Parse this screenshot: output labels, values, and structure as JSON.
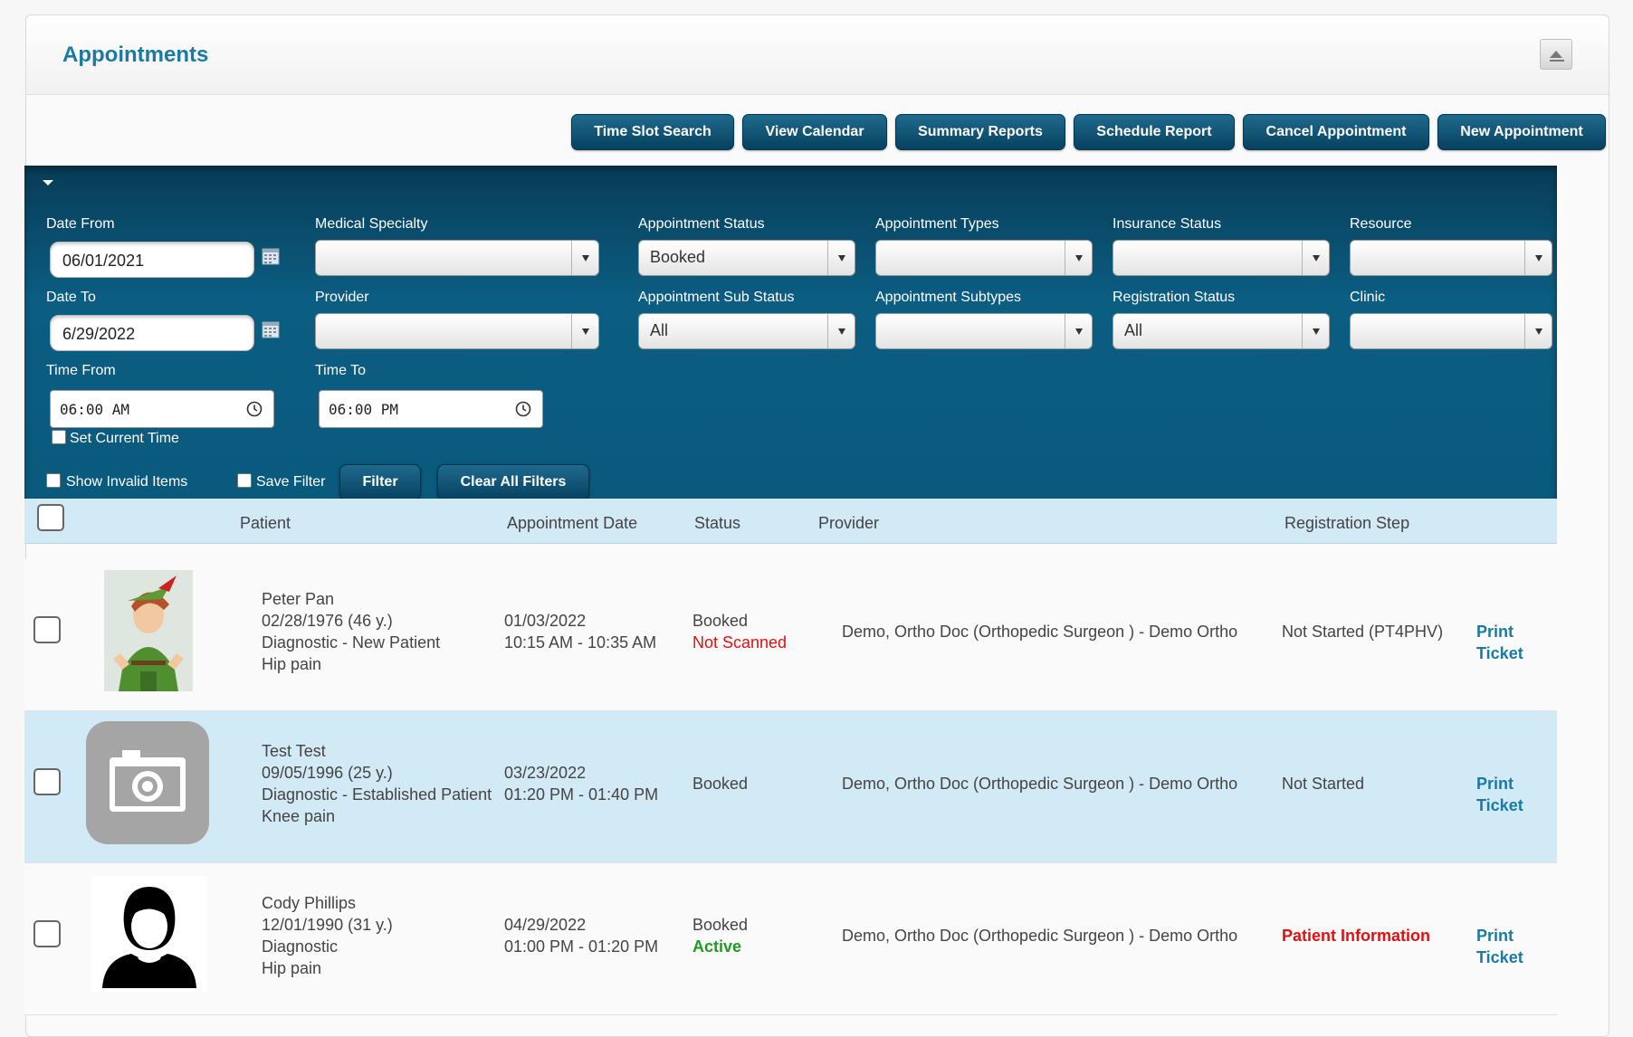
{
  "panel": {
    "title": "Appointments"
  },
  "toolbar": {
    "buttons": [
      "Time Slot Search",
      "View Calendar",
      "Summary Reports",
      "Schedule Report",
      "Cancel Appointment",
      "New Appointment"
    ]
  },
  "filters": {
    "date_from": {
      "label": "Date From",
      "value": "06/01/2021"
    },
    "date_to": {
      "label": "Date To",
      "value": "6/29/2022"
    },
    "time_from": {
      "label": "Time From",
      "value": "06:00 AM"
    },
    "time_to": {
      "label": "Time To",
      "value": "06:00 PM"
    },
    "set_current_time": "Set Current Time",
    "medical_specialty": {
      "label": "Medical Specialty",
      "value": ""
    },
    "provider": {
      "label": "Provider",
      "value": ""
    },
    "appointment_status": {
      "label": "Appointment Status",
      "value": "Booked"
    },
    "appointment_sub_status": {
      "label": "Appointment Sub Status",
      "value": "All"
    },
    "appointment_types": {
      "label": "Appointment Types",
      "value": ""
    },
    "appointment_subtypes": {
      "label": "Appointment Subtypes",
      "value": ""
    },
    "insurance_status": {
      "label": "Insurance Status",
      "value": ""
    },
    "registration_status": {
      "label": "Registration Status",
      "value": "All"
    },
    "resource": {
      "label": "Resource",
      "value": ""
    },
    "clinic": {
      "label": "Clinic",
      "value": ""
    },
    "show_invalid": "Show Invalid Items",
    "save_filter": "Save Filter",
    "filter_button": "Filter",
    "clear_button": "Clear All Filters"
  },
  "grid": {
    "headers": {
      "patient": "Patient",
      "date": "Appointment Date",
      "status": "Status",
      "provider": "Provider",
      "registration": "Registration Step"
    },
    "rows": [
      {
        "name": "Peter Pan",
        "dob": "02/28/1976 (46 y.)",
        "type": "Diagnostic - New Patient",
        "reason": "Hip pain",
        "date": "01/03/2022",
        "time": "10:15 AM - 10:35 AM",
        "status": "Booked",
        "sub_status": "Not Scanned",
        "provider": "Demo, Ortho Doc (Orthopedic Surgeon ) - Demo Ortho",
        "registration": "Not Started (PT4PHV)",
        "action": "Print Ticket"
      },
      {
        "name": "Test Test",
        "dob": "09/05/1996 (25 y.)",
        "type": "Diagnostic - Established Patient",
        "reason": "Knee pain",
        "date": "03/23/2022",
        "time": "01:20 PM - 01:40 PM",
        "status": "Booked",
        "sub_status": "",
        "provider": "Demo, Ortho Doc (Orthopedic Surgeon ) - Demo Ortho",
        "registration": "Not Started",
        "action": "Print Ticket"
      },
      {
        "name": "Cody Phillips",
        "dob": "12/01/1990 (31 y.)",
        "type": "Diagnostic",
        "reason": "Hip pain",
        "date": "04/29/2022",
        "time": "01:00 PM - 01:20 PM",
        "status": "Booked",
        "sub_status": "Active",
        "provider": "Demo, Ortho Doc (Orthopedic Surgeon ) - Demo Ortho",
        "registration": "Patient Information",
        "action": "Print Ticket"
      }
    ]
  },
  "colors": {
    "accent": "#1a7aa5",
    "filter_bg": "#0a5a7d",
    "row_alt": "#d2e9f6",
    "alert": "#e01010",
    "active": "#1f9a22"
  }
}
